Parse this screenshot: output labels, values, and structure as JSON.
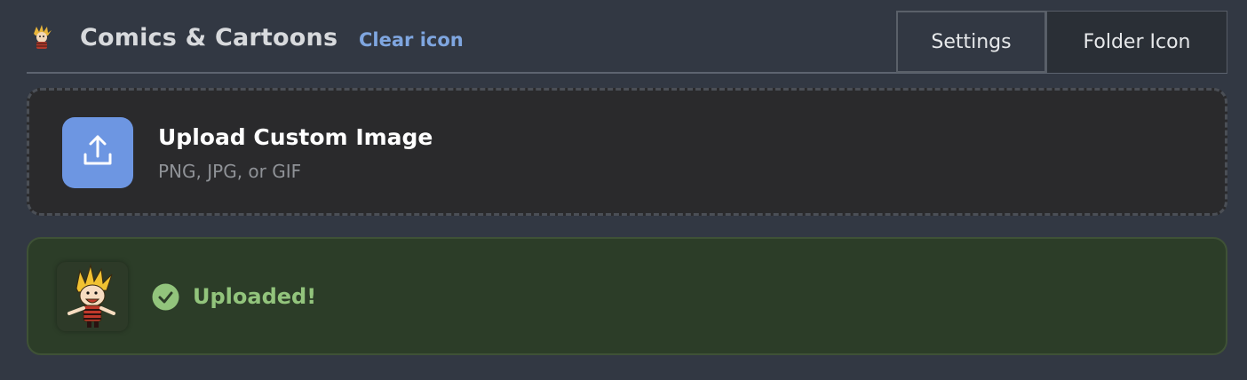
{
  "header": {
    "title": "Comics & Cartoons",
    "clear_link": "Clear icon",
    "folder_icon": "calvin-character-icon"
  },
  "tabs": [
    {
      "label": "Settings",
      "active": false
    },
    {
      "label": "Folder Icon",
      "active": true
    }
  ],
  "upload": {
    "title": "Upload Custom Image",
    "subtitle": "PNG, JPG, or GIF",
    "icon": "upload-icon"
  },
  "result": {
    "status": "Uploaded!",
    "icon": "check-circle-icon",
    "thumbnail": "calvin-character-thumbnail"
  },
  "colors": {
    "background": "#323843",
    "accent_blue": "#6d96e2",
    "link_blue": "#7fa6e0",
    "success_green": "#92c47c",
    "success_bg": "#2c3d28"
  }
}
